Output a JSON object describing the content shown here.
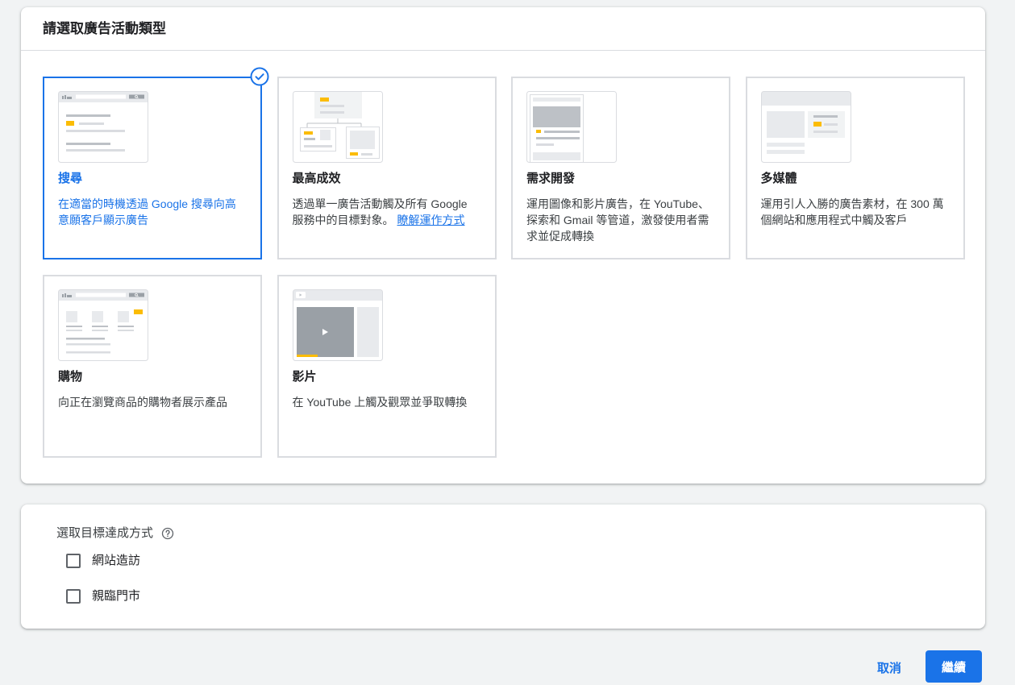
{
  "campaign_type_section": {
    "title": "請選取廣告活動類型",
    "selected_icon": "check-circle-icon",
    "types": [
      {
        "title": "搜尋",
        "description": "在適當的時機透過 Google 搜尋向高意願客戶顯示廣告",
        "illustration": "search-ads-illustration",
        "selected": true
      },
      {
        "title": "最高成效",
        "description": "透過單一廣告活動觸及所有 Google 服務中的目標對象。",
        "link_label": "瞭解運作方式",
        "illustration": "performance-max-illustration",
        "selected": false
      },
      {
        "title": "需求開發",
        "description": "運用圖像和影片廣告，在 YouTube、探索和 Gmail 等管道，激發使用者需求並促成轉換",
        "illustration": "demand-gen-illustration",
        "selected": false
      },
      {
        "title": "多媒體",
        "description": "運用引人入勝的廣告素材，在 300 萬個網站和應用程式中觸及客戶",
        "illustration": "display-ads-illustration",
        "selected": false
      },
      {
        "title": "購物",
        "description": "向正在瀏覽商品的購物者展示產品",
        "illustration": "shopping-ads-illustration",
        "selected": false
      },
      {
        "title": "影片",
        "description": "在 YouTube 上觸及觀眾並爭取轉換",
        "illustration": "video-ads-illustration",
        "selected": false
      }
    ]
  },
  "goal_section": {
    "title": "選取目標達成方式",
    "help_icon": "help-circle-icon",
    "options": [
      {
        "label": "網站造訪",
        "checked": false
      },
      {
        "label": "親臨門市",
        "checked": false
      }
    ]
  },
  "actions": {
    "cancel_label": "取消",
    "continue_label": "繼續"
  },
  "colors": {
    "accent": "#1a73e8",
    "highlight": "#fbbc04"
  }
}
